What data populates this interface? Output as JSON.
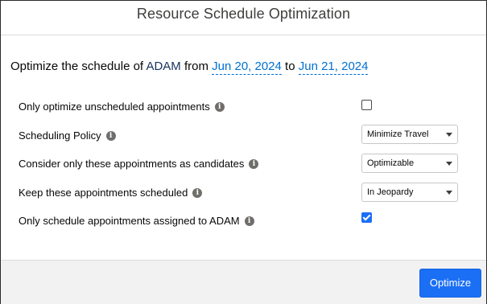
{
  "modal": {
    "title": "Resource Schedule Optimization"
  },
  "summary": {
    "prefix": "Optimize the schedule of",
    "resource": "ADAM",
    "from_word": "from",
    "from_date": "Jun 20, 2024",
    "to_word": "to",
    "to_date": "Jun 21, 2024"
  },
  "options": {
    "unscheduled_label": "Only optimize unscheduled appointments",
    "unscheduled_checked": false,
    "policy_label": "Scheduling Policy",
    "policy_value": "Minimize Travel",
    "candidates_label": "Consider only these appointments as candidates",
    "candidates_value": "Optimizable",
    "keep_label": "Keep these appointments scheduled",
    "keep_value": "In Jeopardy",
    "assigned_label": "Only schedule appointments assigned to ADAM",
    "assigned_checked": true
  },
  "info_icon_glyph": "i",
  "footer": {
    "optimize_label": "Optimize"
  },
  "colors": {
    "accent": "#1b6ff5",
    "link": "#0070d2",
    "footer_bg": "#f3f2f2"
  }
}
